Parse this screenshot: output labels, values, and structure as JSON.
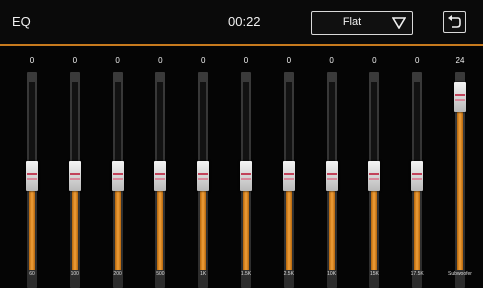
{
  "header": {
    "title": "EQ",
    "time": "00:22",
    "preset": {
      "label": "Flat",
      "icon": "triangle-down-icon"
    },
    "back": {
      "icon": "back-arrow-icon"
    }
  },
  "colors": {
    "accent": "#c77a1e",
    "fill": "#f0a03a",
    "background": "#050505"
  },
  "bands": [
    {
      "label": "60",
      "value": "0",
      "level": 0.5
    },
    {
      "label": "100",
      "value": "0",
      "level": 0.5
    },
    {
      "label": "200",
      "value": "0",
      "level": 0.5
    },
    {
      "label": "500",
      "value": "0",
      "level": 0.5
    },
    {
      "label": "1K",
      "value": "0",
      "level": 0.5
    },
    {
      "label": "1.5K",
      "value": "0",
      "level": 0.5
    },
    {
      "label": "2.5K",
      "value": "0",
      "level": 0.5
    },
    {
      "label": "10K",
      "value": "0",
      "level": 0.5
    },
    {
      "label": "15K",
      "value": "0",
      "level": 0.5
    },
    {
      "label": "17.5K",
      "value": "0",
      "level": 0.5
    },
    {
      "label": "Subwoofer",
      "value": "24",
      "level": 1.0
    }
  ]
}
